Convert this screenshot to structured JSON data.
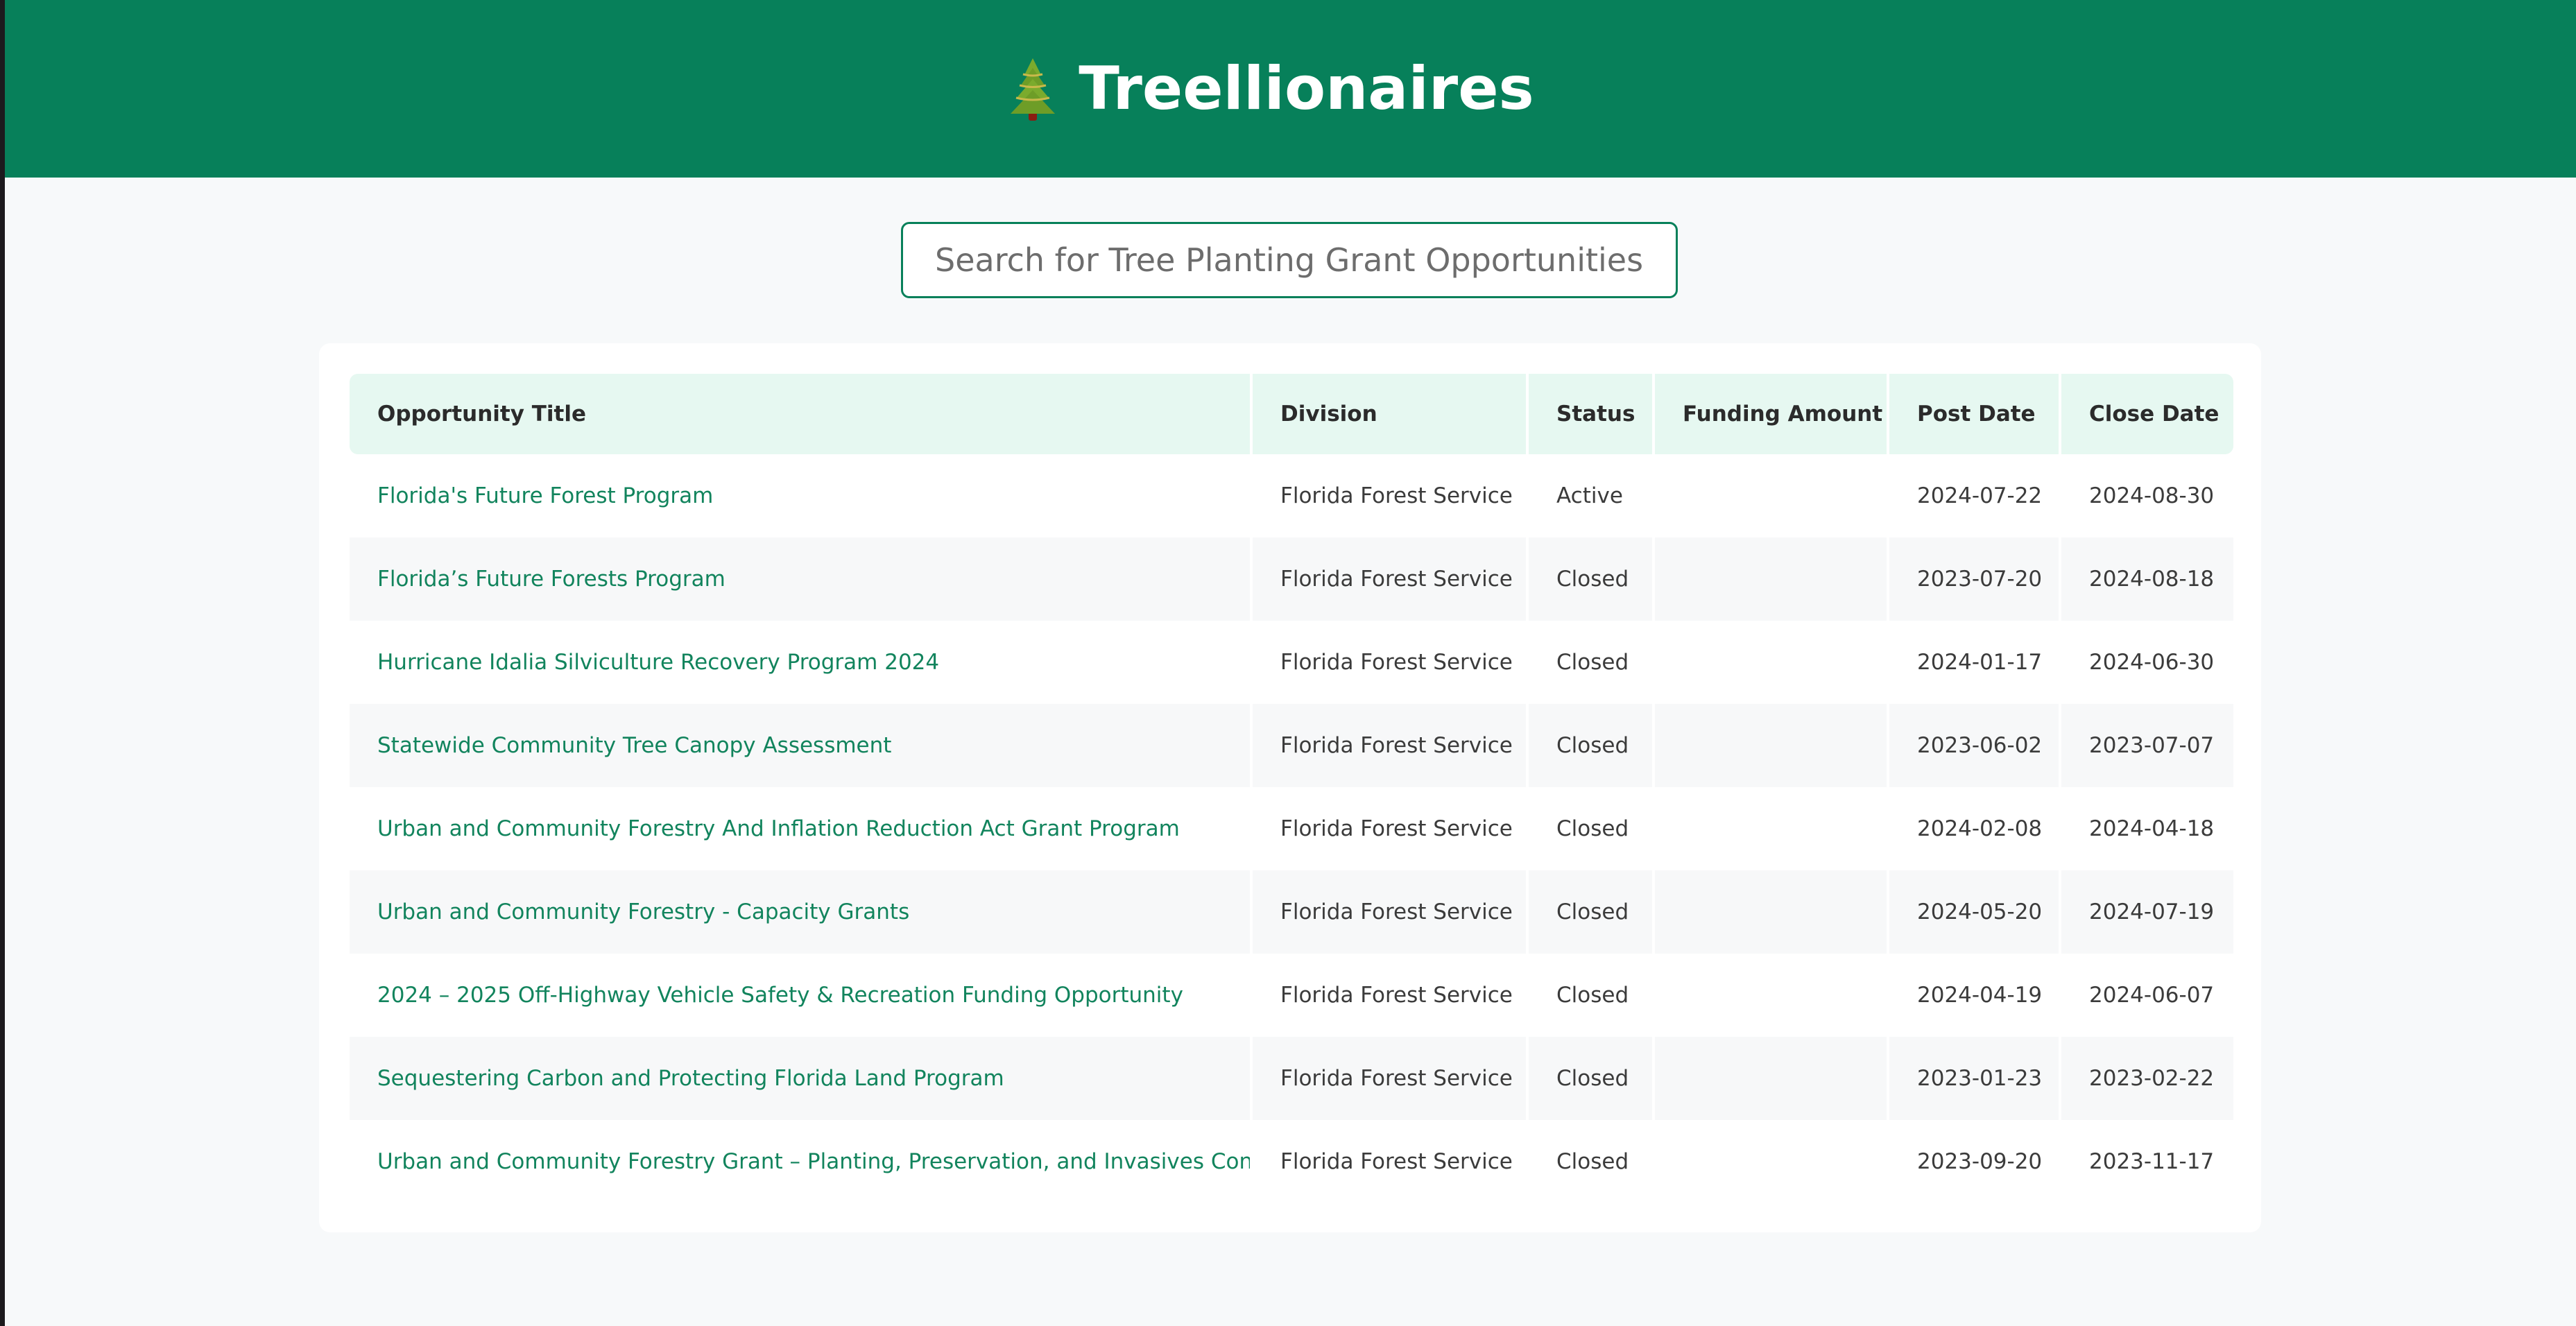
{
  "header": {
    "title": "Treellionaires",
    "icon": "evergreen-tree-icon",
    "color": "#07805a"
  },
  "search": {
    "placeholder": "Search for Tree Planting Grant Opportunities",
    "value": ""
  },
  "table": {
    "columns": [
      "Opportunity Title",
      "Division",
      "Status",
      "Funding Amount",
      "Post Date",
      "Close Date"
    ],
    "rows": [
      {
        "title": "Florida's Future Forest Program",
        "division": "Florida Forest Service",
        "status": "Active",
        "funding": "",
        "post_date": "2024-07-22",
        "close_date": "2024-08-30"
      },
      {
        "title": "Florida’s Future Forests Program",
        "division": "Florida Forest Service",
        "status": "Closed",
        "funding": "",
        "post_date": "2023-07-20",
        "close_date": "2024-08-18"
      },
      {
        "title": "Hurricane Idalia Silviculture Recovery Program 2024",
        "division": "Florida Forest Service",
        "status": "Closed",
        "funding": "",
        "post_date": "2024-01-17",
        "close_date": "2024-06-30"
      },
      {
        "title": "Statewide Community Tree Canopy Assessment",
        "division": "Florida Forest Service",
        "status": "Closed",
        "funding": "",
        "post_date": "2023-06-02",
        "close_date": "2023-07-07"
      },
      {
        "title": "Urban and Community Forestry And Inflation Reduction Act Grant Program",
        "division": "Florida Forest Service",
        "status": "Closed",
        "funding": "",
        "post_date": "2024-02-08",
        "close_date": "2024-04-18"
      },
      {
        "title": "Urban and Community Forestry - Capacity Grants",
        "division": "Florida Forest Service",
        "status": "Closed",
        "funding": "",
        "post_date": "2024-05-20",
        "close_date": "2024-07-19"
      },
      {
        "title": "2024 – 2025 Off-Highway Vehicle Safety & Recreation Funding Opportunity",
        "division": "Florida Forest Service",
        "status": "Closed",
        "funding": "",
        "post_date": "2024-04-19",
        "close_date": "2024-06-07"
      },
      {
        "title": "Sequestering Carbon and Protecting Florida Land Program",
        "division": "Florida Forest Service",
        "status": "Closed",
        "funding": "",
        "post_date": "2023-01-23",
        "close_date": "2023-02-22"
      },
      {
        "title": "Urban and Community Forestry Grant – Planting, Preservation, and Invasives Control",
        "division": "Florida Forest Service",
        "status": "Closed",
        "funding": "",
        "post_date": "2023-09-20",
        "close_date": "2023-11-17"
      }
    ]
  }
}
